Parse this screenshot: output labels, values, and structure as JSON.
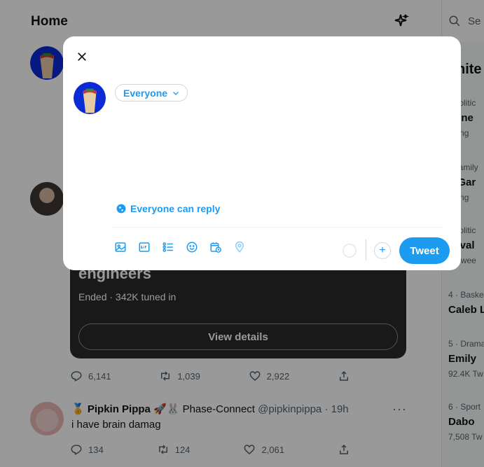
{
  "colors": {
    "accent": "#1d9bf0",
    "text": "#0f1419",
    "muted": "#536471"
  },
  "header": {
    "title": "Home",
    "sparkle_icon": "sparkle-icon"
  },
  "space": {
    "title": "engineers",
    "meta": "Ended · 342K tuned in",
    "view_details_label": "View details",
    "stats": {
      "replies": "6,141",
      "retweets": "1,039",
      "likes": "2,922"
    }
  },
  "tweet2": {
    "name": "Pipkin Pippa",
    "affiliation": "Phase-Connect",
    "handle": "@pipkinpippa",
    "time": "· 19h",
    "text": "i have brain damag",
    "stats": {
      "replies": "134",
      "retweets": "124",
      "likes": "2,061"
    }
  },
  "right_column": {
    "search_placeholder": "Se",
    "header": "nite",
    "trends": [
      {
        "category": "· Politic",
        "title": "raine",
        "count": "nding"
      },
      {
        "category": "· Family",
        "title": "n Gar",
        "count": "nding"
      },
      {
        "category": "· Politic",
        "title": "Javal",
        "count": "K Twee"
      },
      {
        "category": "4 · Baske",
        "title": "Caleb L",
        "count": ""
      },
      {
        "category": "5 · Drama",
        "title": "Emily",
        "count": "92.4K Tw"
      },
      {
        "category": "6 · Sport",
        "title": "Dabo",
        "count": "7,508 Tw"
      }
    ]
  },
  "modal": {
    "audience_label": "Everyone",
    "compose_placeholder": "",
    "reply_setting_label": "Everyone can reply",
    "tweet_button_label": "Tweet",
    "toolbar_icons": [
      "image-icon",
      "gif-icon",
      "poll-icon",
      "emoji-icon",
      "schedule-icon",
      "location-icon"
    ]
  }
}
